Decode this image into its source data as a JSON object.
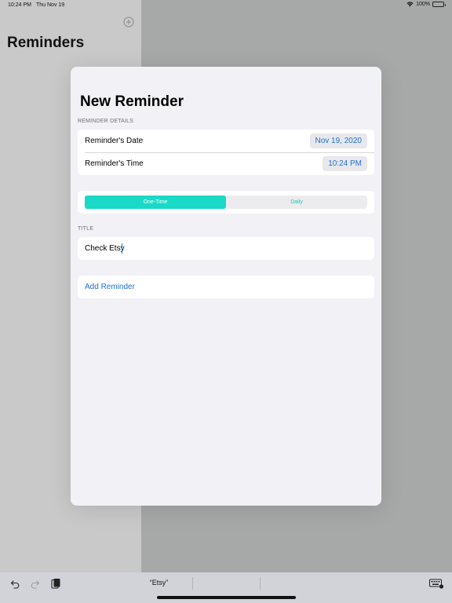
{
  "status_bar": {
    "time": "10:24 PM",
    "date": "Thu Nov 19",
    "battery": "100%",
    "icons": [
      "wifi-icon",
      "battery-icon"
    ]
  },
  "sidebar": {
    "title": "Reminders",
    "add_icon": "add-circle-icon"
  },
  "sheet": {
    "title": "New Reminder",
    "details_header": "REMINDER DETAILS",
    "date_label": "Reminder's Date",
    "date_value": "Nov 19, 2020",
    "time_label": "Reminder's Time",
    "time_value": "10:24 PM",
    "segments": [
      {
        "label": "One-Time",
        "selected": true
      },
      {
        "label": "Daily",
        "selected": false
      }
    ],
    "title_header": "TITLE",
    "title_value": "Check Etsy",
    "add_button": "Add Reminder"
  },
  "keyboard_bar": {
    "suggestion": "“Etsy”",
    "icons": [
      "undo-icon",
      "redo-icon",
      "paste-icon",
      "keyboard-icon"
    ]
  },
  "colors": {
    "accent_blue": "#1f6fd6",
    "segment_active": "#1ad9c6",
    "segment_text": "#19c9b8"
  }
}
